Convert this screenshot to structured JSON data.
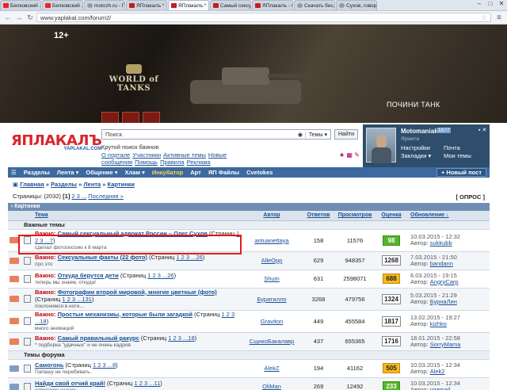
{
  "browser": {
    "tabs": [
      {
        "title": "Белковский ...",
        "fav": "yt",
        "active": false
      },
      {
        "title": "Белковский ...",
        "fav": "yt",
        "active": false
      },
      {
        "title": "motozh.ru - Про...",
        "fav": "gen",
        "active": false
      },
      {
        "title": "ЯПлакалъ",
        "fav": "yp",
        "active": false
      },
      {
        "title": "ЯПлакалъ",
        "fav": "yp",
        "active": true
      },
      {
        "title": "Самый сексуа...",
        "fav": "yp",
        "active": false
      },
      {
        "title": "ЯПлакалъ - Са...",
        "fav": "yp",
        "active": false
      },
      {
        "title": "Скачать бес...",
        "fav": "gen",
        "active": false
      },
      {
        "title": "Сухов, говоря...",
        "fav": "gen",
        "active": false
      }
    ],
    "url": "www.yaplakal.com/forum2/"
  },
  "banner": {
    "age": "12+",
    "logo_text": "WORLD of TANKS",
    "promo": "ПОЧИНИ ТАНК"
  },
  "header": {
    "logo_big": "ЯПЛАКАЛЪ",
    "logo_small": "YAPLAKAL.COM",
    "search_value": "Поиск.",
    "search_scope": "Темы ▾",
    "find_label": "Найти",
    "slogan": "Крутой поиск баянов",
    "links": [
      "О портале",
      "Участники",
      "Активные темы",
      "Новые сообщения",
      "Помощь",
      "Правила",
      "Реклама"
    ]
  },
  "user": {
    "name": "Motomaniak",
    "rep": "1577",
    "city": "Ярмита",
    "links": [
      "Настройки",
      "Почта",
      "Закладки ▾",
      "Мои темы"
    ]
  },
  "nav": {
    "items": [
      {
        "label": "Разделы",
        "accent": false
      },
      {
        "label": "Лента ▾",
        "accent": false
      },
      {
        "label": "Общение ▾",
        "accent": false
      },
      {
        "label": "Хлам ▾",
        "accent": false
      },
      {
        "label": "Инкубатор",
        "accent": true
      },
      {
        "label": "Арт",
        "accent": false
      },
      {
        "label": "ЯП Файлы",
        "accent": false
      },
      {
        "label": "Cvetokes",
        "accent": false
      }
    ],
    "new_post": "Новый пост"
  },
  "crumbs": {
    "home": "Главная",
    "sections": "Разделы",
    "feed": "Лента",
    "current": "Картинки",
    "pages_label": "Страницы: (2032)",
    "current_page": "[1]",
    "other_pages": "2 3 ...",
    "last": "Последняя »",
    "opros": "[ ОПРОС ]"
  },
  "section": {
    "title": "Картинки"
  },
  "table": {
    "headers": {
      "topic": "Тема",
      "author": "Автор",
      "replies": "Ответов",
      "views": "Просмотров",
      "rating": "Оценка",
      "updated": "Обновление ↓"
    },
    "group_important": "Важные темы",
    "group_forum": "Темы форума",
    "important_prefix": "Важно:",
    "rows": [
      {
        "important": true,
        "title": "Самый сексуальный адвокат России – Олег Сухов",
        "pages": "1 2 3 ...7",
        "sub": "сделал фотосессию к 8 марта",
        "author": "antuanettaya",
        "replies": "158",
        "views": "11576",
        "rating": "98",
        "badge": "green",
        "upd_date": "10.03.2015 - 12:32",
        "upd_author": "sukkubb"
      },
      {
        "important": true,
        "title": "Сексуальные факты (22 фото)",
        "pages": "1 2 3 ...26",
        "sub": "про это",
        "author": "AlleOpp",
        "replies": "629",
        "views": "948357",
        "rating": "1268",
        "badge": "white",
        "upd_date": "7.03.2015 - 21:50",
        "upd_author": "bandann"
      },
      {
        "important": true,
        "title": "Откуда берутся дети",
        "pages": "1 2 3 ...26",
        "sub": "теперь мы знаем, откуда!",
        "author": "Shum",
        "replies": "631",
        "views": "2598071",
        "rating": "688",
        "badge": "orange",
        "upd_date": "6.03.2015 - 19:15",
        "upd_author": "AngryCarp"
      },
      {
        "important": true,
        "title": "Фотографии второй мировой, многие цветные (фото)",
        "pages": "1 2 3 ...131",
        "sub": "поклонимся в ноги...",
        "author": "Буратилло",
        "replies": "3268",
        "views": "479756",
        "rating": "1324",
        "badge": "white",
        "upd_date": "5.03.2015 - 21:29",
        "upd_author": "БурнаЛин"
      },
      {
        "important": true,
        "title": "Простые механизмы, которые были загадкой",
        "pages": "1 2 3 ...18",
        "sub": "много анимаций",
        "author": "Graviton",
        "replies": "449",
        "views": "455584",
        "rating": "1817",
        "badge": "white",
        "upd_date": "13.02.2015 - 19:27",
        "upd_author": "kizhko"
      },
      {
        "important": true,
        "title": "Самый правильный ракурс",
        "pages": "1 2 3 ...18",
        "sub": "* подборка \"удачных\" и не очень кадров",
        "author": "СщнкоБакалавр",
        "replies": "437",
        "views": "655365",
        "rating": "1716",
        "badge": "white",
        "upd_date": "18.01.2015 - 22:58",
        "upd_author": "SorryMama"
      },
      {
        "important": false,
        "title": "Самогонь",
        "pages": "1 2 3 ...8",
        "sub": "Папашу не перебивать.",
        "author": "AlekZ",
        "replies": "194",
        "views": "41162",
        "rating": "505",
        "badge": "orange",
        "upd_date": "10.03.2015 - 12:34",
        "upd_author": "Alek2"
      },
      {
        "important": false,
        "title": "Найди свой отчий край!",
        "pages": "1 2 3 ...11",
        "sub": "советские значки",
        "author": "OliMan",
        "replies": "269",
        "views": "12492",
        "rating": "233",
        "badge": "green",
        "upd_date": "10.03.2015 - 12:34",
        "upd_author": "vgamail"
      }
    ]
  },
  "colors": {
    "brand_red": "#d8262b",
    "nav_blue": "#3d6a9e",
    "link": "#1a4f96",
    "highlight": "#e31b1b"
  }
}
